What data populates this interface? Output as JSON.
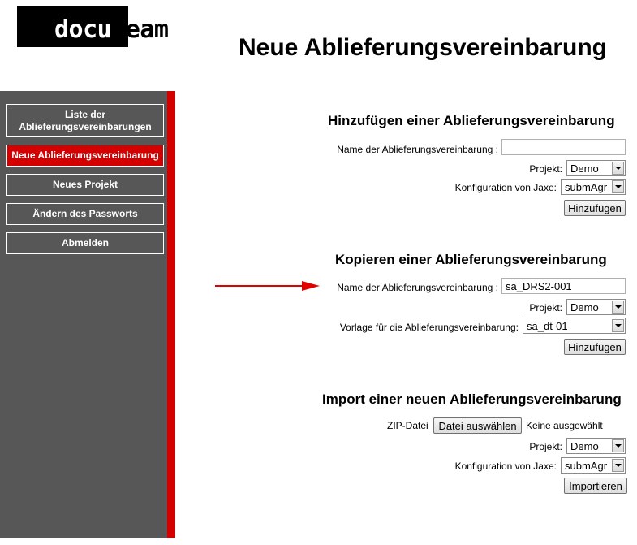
{
  "logo": {
    "part1": "docu",
    "part2": "team"
  },
  "page_title": "Neue Ablieferungsvereinbarung",
  "sidebar": {
    "items": [
      {
        "label": "Liste der\nAblieferungsvereinbarungen",
        "active": false
      },
      {
        "label": "Neue Ablieferungsvereinbarung",
        "active": true
      },
      {
        "label": "Neues Projekt",
        "active": false
      },
      {
        "label": "Ändern des Passworts",
        "active": false
      },
      {
        "label": "Abmelden",
        "active": false
      }
    ]
  },
  "add_section": {
    "title": "Hinzufügen einer Ablieferungsvereinbarung",
    "name_label": "Name der Ablieferungsvereinbarung :",
    "name_value": "",
    "project_label": "Projekt:",
    "project_value": "Demo",
    "config_label": "Konfiguration von Jaxe:",
    "config_value": "submAgr",
    "submit_label": "Hinzufügen"
  },
  "copy_section": {
    "title": "Kopieren einer Ablieferungsvereinbarung",
    "name_label": "Name der Ablieferungsvereinbarung :",
    "name_value": "sa_DRS2-001",
    "project_label": "Projekt:",
    "project_value": "Demo",
    "template_label": "Vorlage für die Ablieferungsvereinbarung:",
    "template_value": "sa_dt-01",
    "submit_label": "Hinzufügen"
  },
  "import_section": {
    "title": "Import einer neuen Ablieferungsvereinbarung",
    "zip_label": "ZIP-Datei",
    "file_button_label": "Datei auswählen",
    "file_status": "Keine ausgewählt",
    "project_label": "Projekt:",
    "project_value": "Demo",
    "config_label": "Konfiguration von Jaxe:",
    "config_value": "submAgr",
    "submit_label": "Importieren"
  },
  "colors": {
    "accent_red": "#d40000",
    "sidebar_gray": "#575757",
    "arrow_red": "#e00000"
  }
}
